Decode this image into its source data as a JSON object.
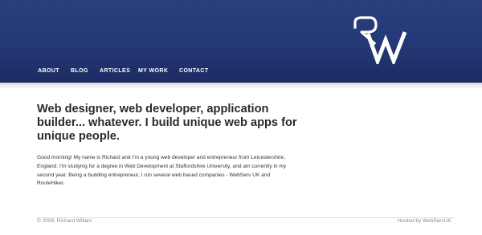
{
  "header": {
    "logo_text": "RW",
    "logo_name": "rw-monogram-logo",
    "background": "#253a78"
  },
  "nav": {
    "items": [
      {
        "label": "ABOUT"
      },
      {
        "label": "BLOG"
      },
      {
        "label": "ARTICLES"
      },
      {
        "label": "MY WORK"
      },
      {
        "label": "CONTACT"
      }
    ]
  },
  "main": {
    "headline": "Web designer, web developer, application builder... whatever. I build unique web apps for unique people.",
    "intro": "Good morning! My name is Richard and I'm a young web developer and entrepreneur from Leicestershire, England. I'm studying for a degree in Web Development at Staffordshire University, and am currently in my second year. Being a budding entrepreneur, I run several web based companies - WebServ UK and RouteHiker."
  },
  "footer": {
    "copyright": "© 2008, Richard Willars",
    "hosted": "Hosted by WebServUK"
  }
}
